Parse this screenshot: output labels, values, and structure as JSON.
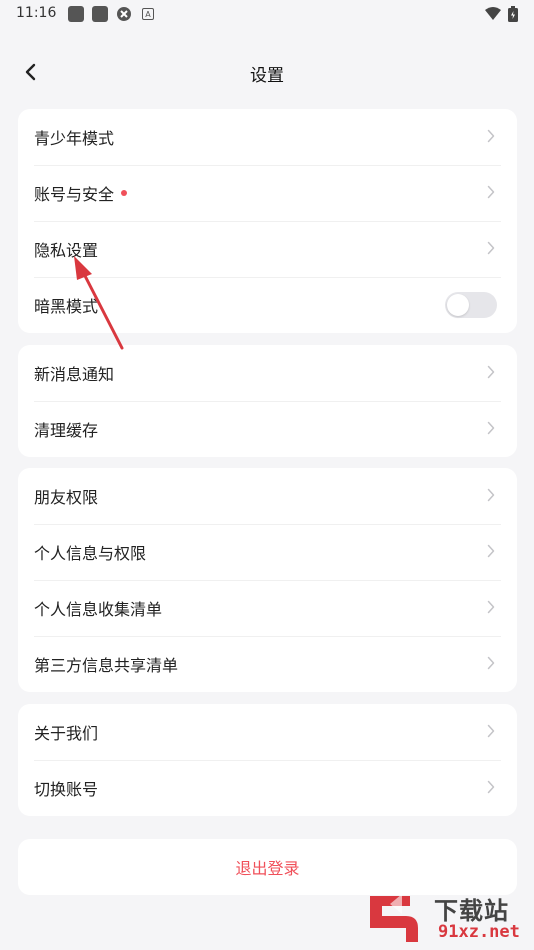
{
  "status_bar": {
    "time": "11:16",
    "app_badge": "A"
  },
  "nav": {
    "title": "设置",
    "back_icon": "chevron-left-icon"
  },
  "groups": [
    {
      "items": [
        {
          "label": "青少年模式",
          "type": "link"
        },
        {
          "label": "账号与安全",
          "type": "link",
          "badge": "red-dot"
        },
        {
          "label": "隐私设置",
          "type": "link"
        },
        {
          "label": "暗黑模式",
          "type": "toggle",
          "value": false
        }
      ]
    },
    {
      "items": [
        {
          "label": "新消息通知",
          "type": "link"
        },
        {
          "label": "清理缓存",
          "type": "link"
        }
      ]
    },
    {
      "items": [
        {
          "label": "朋友权限",
          "type": "link"
        },
        {
          "label": "个人信息与权限",
          "type": "link"
        },
        {
          "label": "个人信息收集清单",
          "type": "link"
        },
        {
          "label": "第三方信息共享清单",
          "type": "link"
        }
      ]
    },
    {
      "items": [
        {
          "label": "关于我们",
          "type": "link"
        },
        {
          "label": "切换账号",
          "type": "link"
        }
      ]
    }
  ],
  "logout": {
    "label": "退出登录"
  },
  "watermark": {
    "title": "下载站",
    "url": "91xz.net"
  },
  "colors": {
    "accent_red": "#f0505a",
    "background": "#f5f5f7",
    "card": "#ffffff",
    "annotation_arrow": "#d9383f"
  }
}
